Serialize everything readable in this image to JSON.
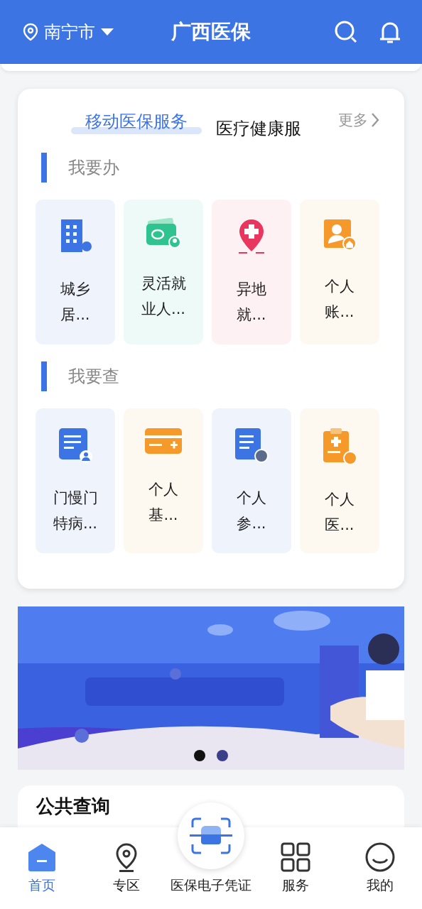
{
  "header": {
    "city": "南宁市",
    "title": "广西医保"
  },
  "tabs": [
    {
      "label": "移动医保服务",
      "selected": true
    },
    {
      "label": "医疗健康服",
      "selected": false
    }
  ],
  "more": "更多",
  "sections": [
    {
      "title": "我要办",
      "tiles": [
        {
          "kind": "building",
          "lines": [
            "城乡",
            "居..."
          ]
        },
        {
          "kind": "wallet",
          "lines": [
            "灵活就",
            "业人..."
          ]
        },
        {
          "kind": "pin",
          "lines": [
            "异地",
            "就..."
          ]
        },
        {
          "kind": "account",
          "lines": [
            "个人",
            "账..."
          ]
        }
      ]
    },
    {
      "title": "我要查",
      "tiles": [
        {
          "kind": "doc",
          "lines": [
            "门慢门",
            "特病..."
          ]
        },
        {
          "kind": "card",
          "lines": [
            "个人",
            "基..."
          ]
        },
        {
          "kind": "insure",
          "lines": [
            "个人",
            "参..."
          ]
        },
        {
          "kind": "bill",
          "lines": [
            "个人",
            "医..."
          ]
        }
      ]
    }
  ],
  "banner": {
    "kind": "picture",
    "dots": [
      {
        "selected": true
      },
      {
        "selected": false
      }
    ]
  },
  "public_query": {
    "title": "公共查询"
  },
  "nav": [
    {
      "kind": "home",
      "label": "首页",
      "selected": true
    },
    {
      "kind": "pin",
      "label": "专区",
      "selected": false
    },
    {
      "kind": "scan",
      "label": "医保电子凭证",
      "selected": false
    },
    {
      "kind": "grid",
      "label": "服务",
      "selected": false
    },
    {
      "kind": "smile",
      "label": "我的",
      "selected": false
    }
  ]
}
